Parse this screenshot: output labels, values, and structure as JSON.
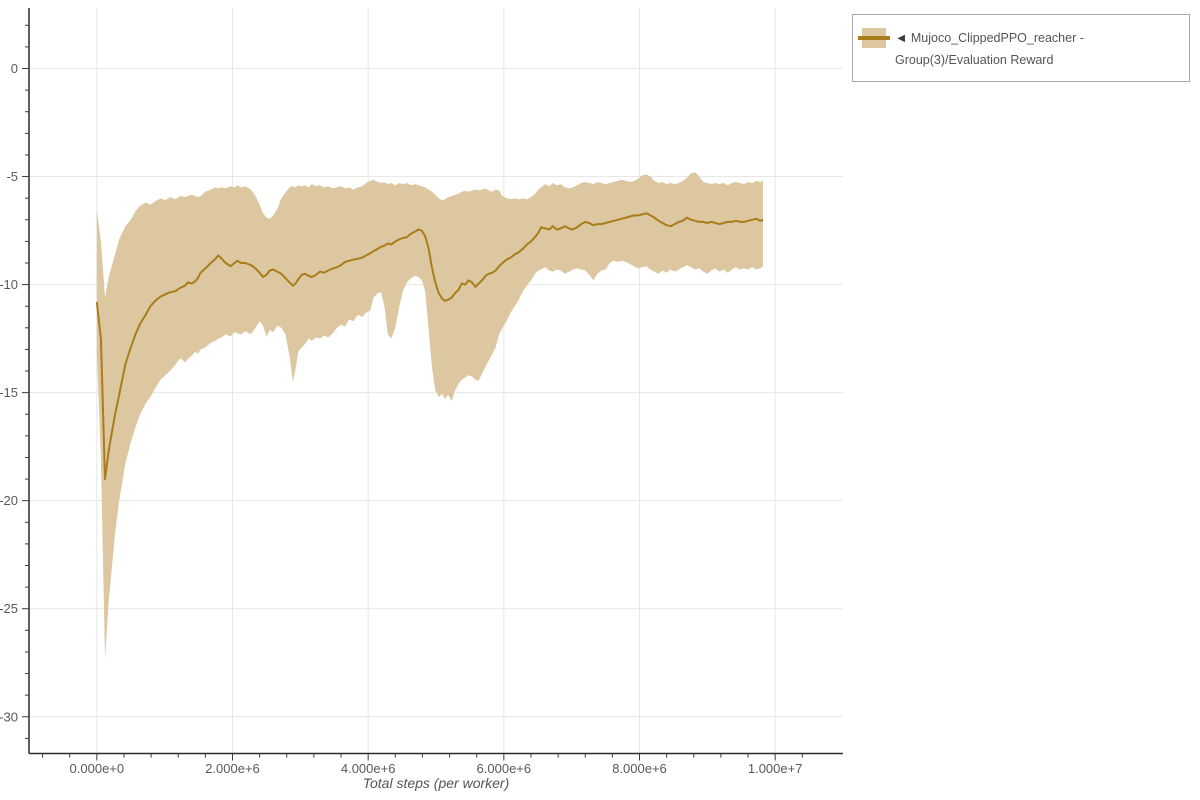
{
  "legend": {
    "collapse_icon": "◄",
    "series_label": "Mujoco_ClippedPPO_reacher - Group(3)/Evaluation Reward"
  },
  "colors": {
    "line": "#a87d1a",
    "band": "#dcc7a0",
    "grid": "#e7e7e7",
    "axis": "#2b2b2b",
    "tick": "#3a3a3a",
    "tick_label": "#595959",
    "legend_border": "#a8a8a8",
    "legend_text": "#555555"
  },
  "chart_data": {
    "type": "line",
    "title": "",
    "xlabel": "Total steps (per worker)",
    "ylabel": "",
    "grid": true,
    "legend_position": "top-right",
    "x_range_e6": [
      -1.0,
      11.0
    ],
    "y_range": [
      -31.7,
      2.8
    ],
    "x_major_ticks": [
      {
        "value_e6": 0,
        "label": "0.000e+0"
      },
      {
        "value_e6": 2,
        "label": "2.000e+6"
      },
      {
        "value_e6": 4,
        "label": "4.000e+6"
      },
      {
        "value_e6": 6,
        "label": "6.000e+6"
      },
      {
        "value_e6": 8,
        "label": "8.000e+6"
      },
      {
        "value_e6": 10,
        "label": "1.000e+7"
      }
    ],
    "x_minor_step_e6": 0.4,
    "y_major_ticks": [
      {
        "value": 0,
        "label": "0"
      },
      {
        "value": -5,
        "label": "-5"
      },
      {
        "value": -10,
        "label": "-10"
      },
      {
        "value": -15,
        "label": "-15"
      },
      {
        "value": -20,
        "label": "-20"
      },
      {
        "value": -25,
        "label": "-25"
      },
      {
        "value": -30,
        "label": "-30"
      }
    ],
    "y_minor_step": 1,
    "series": [
      {
        "name": "Mujoco_ClippedPPO_reacher - Group(3)/Evaluation Reward",
        "points_x_mean_low_high": [
          [
            0.0,
            -10.8,
            -13.2,
            -6.5
          ],
          [
            0.06,
            -12.5,
            -18.0,
            -8.0
          ],
          [
            0.12,
            -19.0,
            -27.3,
            -10.6
          ],
          [
            0.18,
            -17.6,
            -24.5,
            -9.6
          ],
          [
            0.27,
            -16.0,
            -21.5,
            -8.6
          ],
          [
            0.33,
            -15.1,
            -20.0,
            -7.9
          ],
          [
            0.42,
            -13.7,
            -18.3,
            -7.3
          ],
          [
            0.5,
            -12.9,
            -17.3,
            -7.0
          ],
          [
            0.57,
            -12.3,
            -16.6,
            -6.6
          ],
          [
            0.64,
            -11.8,
            -16.0,
            -6.35
          ],
          [
            0.72,
            -11.4,
            -15.5,
            -6.2
          ],
          [
            0.79,
            -11.0,
            -15.2,
            -6.3
          ],
          [
            0.86,
            -10.75,
            -14.8,
            -6.15
          ],
          [
            0.94,
            -10.55,
            -14.4,
            -6.0
          ],
          [
            1.01,
            -10.45,
            -14.2,
            -6.1
          ],
          [
            1.08,
            -10.35,
            -14.0,
            -5.95
          ],
          [
            1.16,
            -10.3,
            -13.7,
            -6.05
          ],
          [
            1.23,
            -10.15,
            -13.4,
            -5.9
          ],
          [
            1.3,
            -10.05,
            -13.6,
            -5.95
          ],
          [
            1.34,
            -9.9,
            -13.45,
            -5.9
          ],
          [
            1.4,
            -9.95,
            -13.3,
            -5.85
          ],
          [
            1.45,
            -9.85,
            -13.1,
            -5.9
          ],
          [
            1.49,
            -9.7,
            -13.2,
            -5.95
          ],
          [
            1.53,
            -9.45,
            -13.0,
            -5.9
          ],
          [
            1.6,
            -9.25,
            -12.9,
            -5.7
          ],
          [
            1.68,
            -9.0,
            -12.7,
            -5.6
          ],
          [
            1.75,
            -8.8,
            -12.6,
            -5.5
          ],
          [
            1.79,
            -8.65,
            -12.5,
            -5.55
          ],
          [
            1.84,
            -8.8,
            -12.45,
            -5.5
          ],
          [
            1.9,
            -9.0,
            -12.3,
            -5.55
          ],
          [
            1.97,
            -9.15,
            -12.4,
            -5.45
          ],
          [
            2.03,
            -9.0,
            -12.2,
            -5.5
          ],
          [
            2.07,
            -8.9,
            -12.25,
            -5.4
          ],
          [
            2.13,
            -9.0,
            -12.3,
            -5.5
          ],
          [
            2.19,
            -9.0,
            -12.15,
            -5.45
          ],
          [
            2.27,
            -9.1,
            -12.3,
            -5.6
          ],
          [
            2.34,
            -9.25,
            -12.0,
            -5.9
          ],
          [
            2.4,
            -9.45,
            -11.7,
            -6.3
          ],
          [
            2.45,
            -9.65,
            -11.9,
            -6.7
          ],
          [
            2.5,
            -9.55,
            -12.4,
            -6.9
          ],
          [
            2.55,
            -9.35,
            -12.1,
            -6.95
          ],
          [
            2.6,
            -9.3,
            -12.2,
            -6.8
          ],
          [
            2.66,
            -9.4,
            -11.9,
            -6.5
          ],
          [
            2.72,
            -9.5,
            -12.0,
            -6.0
          ],
          [
            2.78,
            -9.7,
            -12.3,
            -5.75
          ],
          [
            2.84,
            -9.9,
            -13.3,
            -5.5
          ],
          [
            2.89,
            -10.05,
            -14.5,
            -5.45
          ],
          [
            2.93,
            -9.95,
            -13.9,
            -5.5
          ],
          [
            2.97,
            -9.75,
            -13.1,
            -5.4
          ],
          [
            3.02,
            -9.55,
            -12.9,
            -5.45
          ],
          [
            3.07,
            -9.5,
            -12.75,
            -5.4
          ],
          [
            3.12,
            -9.6,
            -12.5,
            -5.5
          ],
          [
            3.17,
            -9.65,
            -12.6,
            -5.35
          ],
          [
            3.23,
            -9.55,
            -12.45,
            -5.45
          ],
          [
            3.29,
            -9.4,
            -12.5,
            -5.4
          ],
          [
            3.35,
            -9.45,
            -12.35,
            -5.5
          ],
          [
            3.41,
            -9.35,
            -12.45,
            -5.45
          ],
          [
            3.48,
            -9.25,
            -12.25,
            -5.55
          ],
          [
            3.54,
            -9.2,
            -12.0,
            -5.5
          ],
          [
            3.6,
            -9.1,
            -11.85,
            -5.45
          ],
          [
            3.66,
            -8.95,
            -11.95,
            -5.55
          ],
          [
            3.72,
            -8.9,
            -11.6,
            -5.5
          ],
          [
            3.78,
            -8.85,
            -11.7,
            -5.6
          ],
          [
            3.85,
            -8.8,
            -11.4,
            -5.5
          ],
          [
            3.91,
            -8.75,
            -11.5,
            -5.45
          ],
          [
            3.97,
            -8.65,
            -11.3,
            -5.3
          ],
          [
            4.03,
            -8.55,
            -11.2,
            -5.2
          ],
          [
            4.08,
            -8.45,
            -10.6,
            -5.15
          ],
          [
            4.14,
            -8.35,
            -10.4,
            -5.25
          ],
          [
            4.19,
            -8.25,
            -10.35,
            -5.3
          ],
          [
            4.24,
            -8.2,
            -11.0,
            -5.25
          ],
          [
            4.29,
            -8.1,
            -12.3,
            -5.35
          ],
          [
            4.34,
            -8.15,
            -12.5,
            -5.3
          ],
          [
            4.4,
            -8.0,
            -12.0,
            -5.4
          ],
          [
            4.46,
            -7.9,
            -11.0,
            -5.3
          ],
          [
            4.51,
            -7.85,
            -10.3,
            -5.35
          ],
          [
            4.57,
            -7.8,
            -9.9,
            -5.3
          ],
          [
            4.63,
            -7.65,
            -9.7,
            -5.4
          ],
          [
            4.69,
            -7.55,
            -9.6,
            -5.35
          ],
          [
            4.74,
            -7.45,
            -9.65,
            -5.4
          ],
          [
            4.79,
            -7.5,
            -9.8,
            -5.45
          ],
          [
            4.84,
            -7.75,
            -10.3,
            -5.5
          ],
          [
            4.89,
            -8.3,
            -12.0,
            -5.6
          ],
          [
            4.94,
            -9.2,
            -13.8,
            -5.7
          ],
          [
            4.99,
            -9.9,
            -14.9,
            -5.85
          ],
          [
            5.04,
            -10.4,
            -15.2,
            -6.0
          ],
          [
            5.09,
            -10.65,
            -15.05,
            -6.1
          ],
          [
            5.13,
            -10.75,
            -15.3,
            -6.05
          ],
          [
            5.18,
            -10.7,
            -15.1,
            -5.95
          ],
          [
            5.23,
            -10.6,
            -15.4,
            -5.9
          ],
          [
            5.28,
            -10.4,
            -14.9,
            -5.85
          ],
          [
            5.33,
            -10.25,
            -14.6,
            -5.8
          ],
          [
            5.38,
            -9.95,
            -14.4,
            -5.7
          ],
          [
            5.43,
            -10.0,
            -14.3,
            -5.65
          ],
          [
            5.48,
            -9.8,
            -14.2,
            -5.7
          ],
          [
            5.53,
            -9.9,
            -14.25,
            -5.65
          ],
          [
            5.58,
            -10.1,
            -14.4,
            -5.6
          ],
          [
            5.63,
            -9.95,
            -14.45,
            -5.65
          ],
          [
            5.68,
            -9.8,
            -14.1,
            -5.6
          ],
          [
            5.73,
            -9.6,
            -13.8,
            -5.55
          ],
          [
            5.78,
            -9.5,
            -13.5,
            -5.65
          ],
          [
            5.83,
            -9.45,
            -13.2,
            -5.7
          ],
          [
            5.88,
            -9.35,
            -12.9,
            -5.6
          ],
          [
            5.93,
            -9.15,
            -12.3,
            -5.65
          ],
          [
            5.98,
            -9.0,
            -12.0,
            -5.9
          ],
          [
            6.04,
            -8.85,
            -11.7,
            -6.0
          ],
          [
            6.1,
            -8.75,
            -11.3,
            -6.05
          ],
          [
            6.16,
            -8.6,
            -11.0,
            -6.0
          ],
          [
            6.22,
            -8.5,
            -10.7,
            -6.05
          ],
          [
            6.28,
            -8.35,
            -10.3,
            -6.0
          ],
          [
            6.34,
            -8.15,
            -10.05,
            -6.05
          ],
          [
            6.4,
            -8.0,
            -9.8,
            -5.95
          ],
          [
            6.46,
            -7.8,
            -9.5,
            -5.8
          ],
          [
            6.51,
            -7.6,
            -9.35,
            -5.6
          ],
          [
            6.55,
            -7.35,
            -9.3,
            -5.5
          ],
          [
            6.61,
            -7.4,
            -9.2,
            -5.35
          ],
          [
            6.67,
            -7.45,
            -9.35,
            -5.45
          ],
          [
            6.72,
            -7.3,
            -9.4,
            -5.3
          ],
          [
            6.78,
            -7.45,
            -9.3,
            -5.4
          ],
          [
            6.84,
            -7.4,
            -9.35,
            -5.35
          ],
          [
            6.9,
            -7.3,
            -9.5,
            -5.5
          ],
          [
            6.96,
            -7.4,
            -9.4,
            -5.55
          ],
          [
            7.02,
            -7.45,
            -9.3,
            -5.5
          ],
          [
            7.08,
            -7.35,
            -9.25,
            -5.4
          ],
          [
            7.14,
            -7.2,
            -9.3,
            -5.3
          ],
          [
            7.2,
            -7.1,
            -9.35,
            -5.25
          ],
          [
            7.26,
            -7.15,
            -9.55,
            -5.3
          ],
          [
            7.32,
            -7.25,
            -9.8,
            -5.35
          ],
          [
            7.38,
            -7.2,
            -9.5,
            -5.25
          ],
          [
            7.44,
            -7.2,
            -9.35,
            -5.3
          ],
          [
            7.5,
            -7.15,
            -9.3,
            -5.35
          ],
          [
            7.56,
            -7.1,
            -9.0,
            -5.3
          ],
          [
            7.62,
            -7.05,
            -8.9,
            -5.25
          ],
          [
            7.68,
            -7.0,
            -8.95,
            -5.2
          ],
          [
            7.74,
            -6.95,
            -8.9,
            -5.15
          ],
          [
            7.8,
            -6.9,
            -8.95,
            -5.2
          ],
          [
            7.86,
            -6.85,
            -9.05,
            -5.25
          ],
          [
            7.92,
            -6.8,
            -9.15,
            -5.2
          ],
          [
            7.98,
            -6.8,
            -9.25,
            -5.1
          ],
          [
            8.04,
            -6.75,
            -9.2,
            -4.95
          ],
          [
            8.1,
            -6.7,
            -9.15,
            -4.9
          ],
          [
            8.16,
            -6.8,
            -9.3,
            -5.0
          ],
          [
            8.22,
            -6.9,
            -9.4,
            -5.2
          ],
          [
            8.28,
            -7.05,
            -9.5,
            -5.3
          ],
          [
            8.34,
            -7.15,
            -9.35,
            -5.25
          ],
          [
            8.4,
            -7.25,
            -9.45,
            -5.35
          ],
          [
            8.46,
            -7.3,
            -9.3,
            -5.3
          ],
          [
            8.52,
            -7.2,
            -9.4,
            -5.35
          ],
          [
            8.58,
            -7.1,
            -9.3,
            -5.3
          ],
          [
            8.64,
            -7.05,
            -9.2,
            -5.2
          ],
          [
            8.7,
            -6.9,
            -9.1,
            -5.05
          ],
          [
            8.76,
            -7.0,
            -9.2,
            -4.85
          ],
          [
            8.82,
            -7.05,
            -9.3,
            -4.8
          ],
          [
            8.88,
            -7.1,
            -9.25,
            -5.0
          ],
          [
            8.94,
            -7.1,
            -9.4,
            -5.25
          ],
          [
            9.0,
            -7.15,
            -9.5,
            -5.3
          ],
          [
            9.06,
            -7.1,
            -9.35,
            -5.35
          ],
          [
            9.12,
            -7.15,
            -9.25,
            -5.3
          ],
          [
            9.18,
            -7.2,
            -9.4,
            -5.35
          ],
          [
            9.24,
            -7.15,
            -9.3,
            -5.3
          ],
          [
            9.3,
            -7.1,
            -9.45,
            -5.4
          ],
          [
            9.36,
            -7.1,
            -9.3,
            -5.3
          ],
          [
            9.42,
            -7.05,
            -9.2,
            -5.25
          ],
          [
            9.48,
            -7.1,
            -9.3,
            -5.3
          ],
          [
            9.54,
            -7.1,
            -9.25,
            -5.35
          ],
          [
            9.6,
            -7.05,
            -9.3,
            -5.25
          ],
          [
            9.66,
            -7.0,
            -9.2,
            -5.3
          ],
          [
            9.72,
            -6.95,
            -9.3,
            -5.2
          ],
          [
            9.78,
            -7.05,
            -9.25,
            -5.25
          ],
          [
            9.82,
            -7.0,
            -9.15,
            -5.2
          ]
        ]
      }
    ]
  }
}
